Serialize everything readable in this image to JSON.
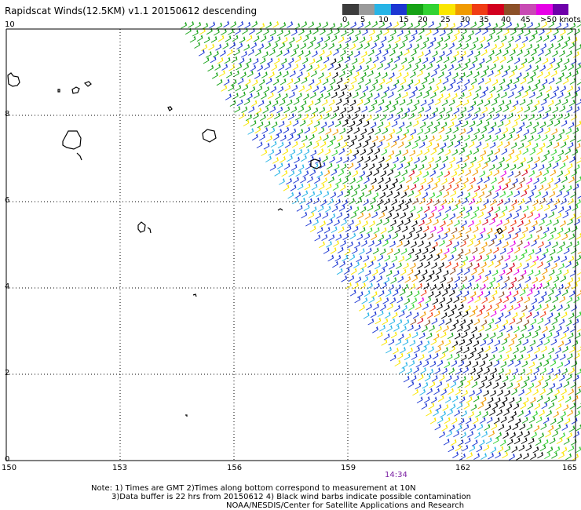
{
  "title": "Rapidscat Winds(12.5KM) v1.1 20150612 descending",
  "legend": {
    "colors": [
      "#3c3c3c",
      "#9a9a9a",
      "#27b4e6",
      "#1c36d2",
      "#16a216",
      "#32d232",
      "#fae600",
      "#f09a00",
      "#f03c14",
      "#d2001e",
      "#8c5028",
      "#c84ab4",
      "#e600e6",
      "#6e00aa"
    ],
    "labels": [
      "0",
      "5",
      "10",
      "15",
      "20",
      "25",
      "30",
      "35",
      "40",
      "45",
      ">50 knots"
    ]
  },
  "axes": {
    "y_labels": [
      "10",
      "8",
      "6",
      "4",
      "2",
      "0"
    ],
    "x_labels": [
      "150",
      "153",
      "156",
      "159",
      "162",
      "165"
    ]
  },
  "time_label": "14:34",
  "notes": [
    "Note: 1) Times are GMT 2)Times along bottom correspond to measurement at 10N",
    "3)Data buffer is 22 hrs from 20150612 4) Black wind barbs indicate possible contamination",
    "NOAA/NESDIS/Center for Satellite Applications and Research"
  ]
}
